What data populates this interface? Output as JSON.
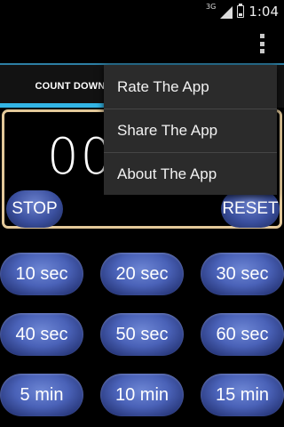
{
  "status_bar": {
    "network": "3G",
    "time": "1:04"
  },
  "tabs": [
    {
      "label": "COUNT DOWN",
      "selected": true
    }
  ],
  "timer": {
    "display_partial": "00",
    "stop_label": "STOP",
    "reset_label": "RESET"
  },
  "presets": [
    [
      "10 sec",
      "20 sec",
      "30 sec"
    ],
    [
      "40 sec",
      "50 sec",
      "60 sec"
    ],
    [
      "5 min",
      "10 min",
      "15 min"
    ]
  ],
  "menu": {
    "items": [
      "Rate The App",
      "Share The App",
      "About The App"
    ]
  },
  "colors": {
    "tab_indicator": "#33b5e5",
    "panel_border": "#e3c99a",
    "button_blue": "#4a62b8"
  }
}
